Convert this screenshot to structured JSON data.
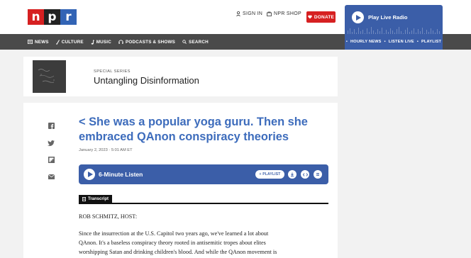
{
  "header": {
    "logo": [
      "n",
      "p",
      "r"
    ],
    "sign_in": "SIGN IN",
    "npr_shop": "NPR SHOP",
    "donate": "DONATE"
  },
  "live_radio": {
    "label": "Play Live Radio",
    "links": [
      "HOURLY NEWS",
      "LISTEN LIVE",
      "PLAYLIST"
    ]
  },
  "nav": {
    "items": [
      {
        "label": "NEWS",
        "icon": "news-icon"
      },
      {
        "label": "CULTURE",
        "icon": "culture-icon"
      },
      {
        "label": "MUSIC",
        "icon": "music-icon"
      },
      {
        "label": "PODCASTS & SHOWS",
        "icon": "podcast-icon"
      },
      {
        "label": "SEARCH",
        "icon": "search-icon"
      }
    ]
  },
  "series": {
    "kicker": "SPECIAL SERIES",
    "title": "Untangling Disinformation",
    "thumbnail": "chalkboard-image"
  },
  "article": {
    "headline": "< She was a popular yoga guru. Then she embraced QAnon conspiracy theories",
    "date": "January 2, 2023 · 5:01 AM ET",
    "share_icons": [
      "facebook-icon",
      "twitter-icon",
      "flipboard-icon",
      "email-icon"
    ],
    "player": {
      "label": "6-Minute Listen",
      "add_playlist": "+ PLAYLIST",
      "buttons": [
        "download-icon",
        "embed-icon",
        "transcript-icon"
      ]
    },
    "transcript_tab": "Transcript",
    "speaker": "ROB SCHMITZ, HOST:",
    "body": [
      "Since the insurrection at the U.S. Capitol two years ago, we've learned a lot about",
      "QAnon. It's a baseless conspiracy theory rooted in antisemitic tropes about elites",
      "worshipping Satan and drinking children's blood. And while the QAnon movement is"
    ]
  },
  "colors": {
    "npr_red": "#d62021",
    "npr_blue": "#3b5ea8",
    "headline_blue": "#3d6cbc",
    "nav_gray": "#4a4a4a"
  }
}
